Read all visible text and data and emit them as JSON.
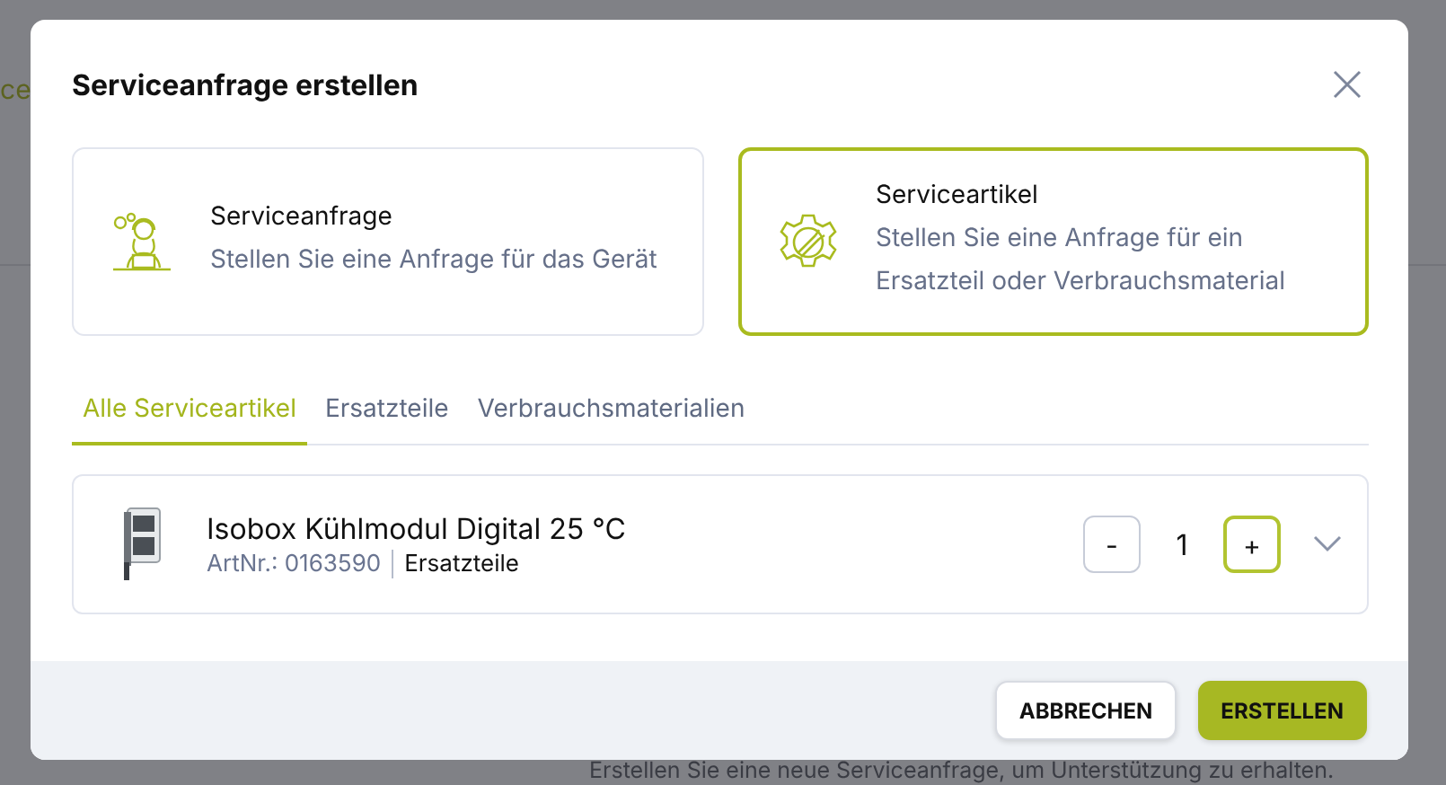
{
  "background": {
    "tab_fragment": "ce",
    "hint": "Erstellen Sie eine neue Serviceanfrage, um Unterstützung zu erhalten."
  },
  "dialog": {
    "title": "Serviceanfrage erstellen",
    "options": [
      {
        "kind": "request",
        "title": "Serviceanfrage",
        "description": "Stellen Sie eine Anfrage für das Gerät",
        "selected": false
      },
      {
        "kind": "article",
        "title": "Serviceartikel",
        "description": "Stellen Sie eine Anfrage für ein Ersatzteil oder Verbrauchsmaterial",
        "selected": true
      }
    ],
    "tabs": [
      {
        "label": "Alle Serviceartikel",
        "selected": true
      },
      {
        "label": "Ersatzteile",
        "selected": false
      },
      {
        "label": "Verbrauchsmaterialien",
        "selected": false
      }
    ],
    "items": [
      {
        "name": "Isobox Kühlmodul Digital 25 °C",
        "article_no": "ArtNr.: 0163590",
        "category": "Ersatzteile",
        "decrement": "-",
        "quantity": "1",
        "increment": "+"
      }
    ],
    "buttons": [
      {
        "kind": "secondary",
        "label": "ABBRECHEN"
      },
      {
        "kind": "primary",
        "label": "ERSTELLEN"
      }
    ]
  }
}
